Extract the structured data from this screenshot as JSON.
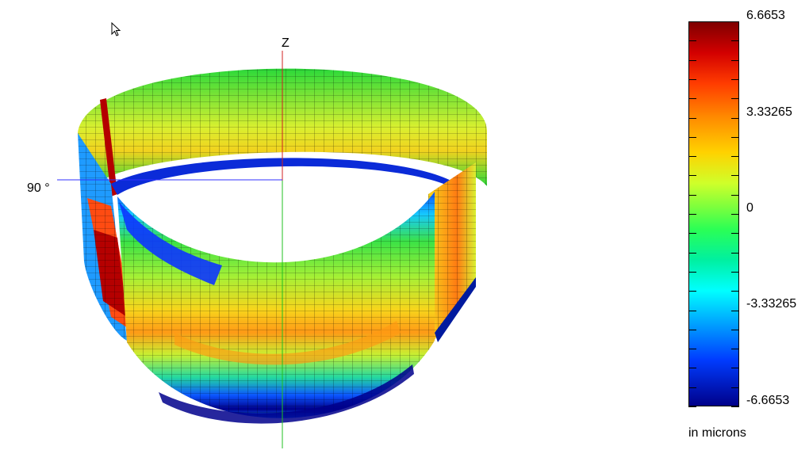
{
  "view": {
    "axis_label": "Z",
    "angle_label": "90 °"
  },
  "colorbar": {
    "labels": [
      "6.6653",
      "3.33265",
      "0",
      "-3.33265",
      "-6.6653"
    ],
    "units": "in microns",
    "colors": [
      "#7f0000",
      "#ff8c00",
      "#7fff3c",
      "#00ffff",
      "#00008a"
    ]
  },
  "icons": {
    "cursor": "mouse-pointer-icon"
  }
}
